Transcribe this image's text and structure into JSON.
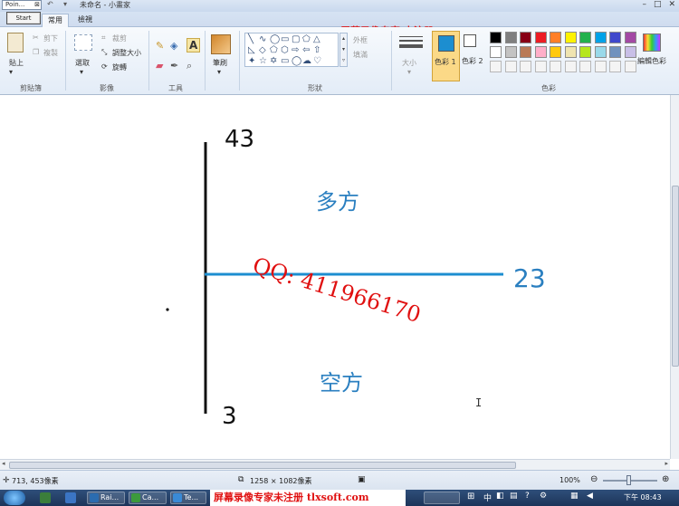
{
  "titlebar": {
    "app_tab": "Poin...",
    "title": "未命名 - 小畫家",
    "controls": [
      "–",
      "□",
      "✕"
    ]
  },
  "tabs": {
    "start": "Start",
    "home": "常用",
    "view": "檢視"
  },
  "ribbon": {
    "clipboard": {
      "paste": "貼上",
      "cut": "剪下",
      "copy": "複製",
      "label": "剪貼簿"
    },
    "image": {
      "select": "選取",
      "crop": "裁剪",
      "resize": "調整大小",
      "rotate": "旋轉",
      "label": "影像"
    },
    "tools": {
      "label": "工具"
    },
    "brushes": {
      "label": "筆刷"
    },
    "shapes": {
      "outline": "外框",
      "fill": "填滿",
      "label": "形狀"
    },
    "size": {
      "label": "大小"
    },
    "colors": {
      "color1": "色彩 1",
      "color2": "色彩 2",
      "edit": "編輯色彩",
      "label": "色彩",
      "primary": "#1c8ed0",
      "palette": [
        "#000000",
        "#7f7f7f",
        "#880015",
        "#ed1c24",
        "#ff7f27",
        "#fff200",
        "#22b14c",
        "#00a2e8",
        "#3f48cc",
        "#a349a4",
        "#ffffff",
        "#c3c3c3",
        "#b97a57",
        "#ffaec9",
        "#ffc90e",
        "#efe4b0",
        "#b5e61d",
        "#99d9ea",
        "#7092be",
        "#c8bfe7"
      ]
    }
  },
  "canvas": {
    "top_label": "43",
    "bottom_label": "3",
    "right_label": "23",
    "upper_region": "多方",
    "lower_region": "空方",
    "watermark": "QQ: 411966170",
    "line_color": "#1c8ed0",
    "text_color": "#2a7fc0"
  },
  "watermark_top": "屏幕录像专家 未注册",
  "statusbar": {
    "cursor_pos": "713, 453像素",
    "canvas_size": "1258 × 1082像素",
    "zoom": "100%"
  },
  "taskbar": {
    "items": [
      "Rai...",
      "Ca...",
      "Te..."
    ],
    "watermark": "屏幕录像专家未注册 tlxsoft.com",
    "clock": "下午 08:43"
  }
}
